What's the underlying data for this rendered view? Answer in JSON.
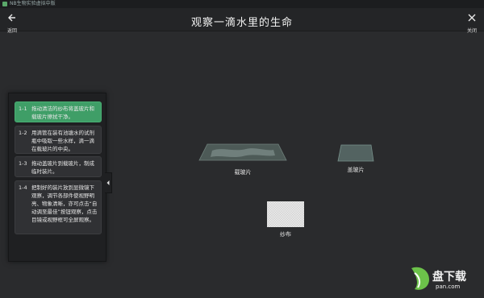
{
  "window": {
    "title": "NB生物实验虚拟中版"
  },
  "header": {
    "title": "观察一滴水里的生命",
    "back_label": "返回",
    "close_label": "关闭"
  },
  "steps": [
    {
      "num": "1-1",
      "text": "拖动清洁的纱布将盖玻片和载玻片擦拭干净。",
      "active": true
    },
    {
      "num": "1-2",
      "text": "用滴管在装有池塘水的试剂瓶中吸取一些水样，滴一滴在载玻片的中央。",
      "active": false
    },
    {
      "num": "1-3",
      "text": "拖动盖玻片到载玻片，制成临时装片。",
      "active": false
    },
    {
      "num": "1-4",
      "text": "把制好的装片放到显微镜下观察，调节各部件使视野明亮、物象清晰，亦可点击“自动调至最佳”按钮观察，点击目镜或视野框可全屏观察。",
      "active": false
    }
  ],
  "objects": {
    "slide_label": "载玻片",
    "coverslip_label": "盖玻片",
    "gauze_label": "纱布"
  },
  "watermark": {
    "main": "盘下载",
    "sub": "pan.com"
  },
  "colors": {
    "accent": "#3f9e67",
    "background": "#2a2b2d",
    "watermark_green": "#6cc24a"
  }
}
